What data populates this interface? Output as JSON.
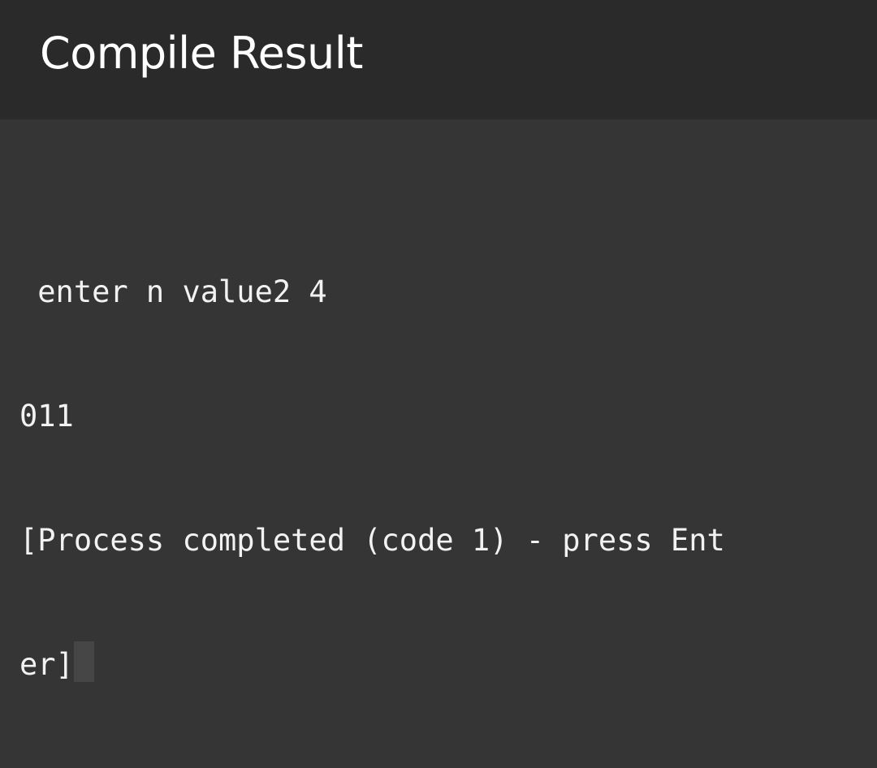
{
  "header": {
    "title": "Compile Result"
  },
  "terminal": {
    "lines": [
      " enter n value2 4",
      "011",
      "[Process completed (code 1) - press Ent",
      "er]"
    ]
  },
  "colors": {
    "header_bg": "#2a2a2a",
    "terminal_bg": "#353535",
    "text": "#f2f2f2",
    "cursor": "#464646"
  }
}
